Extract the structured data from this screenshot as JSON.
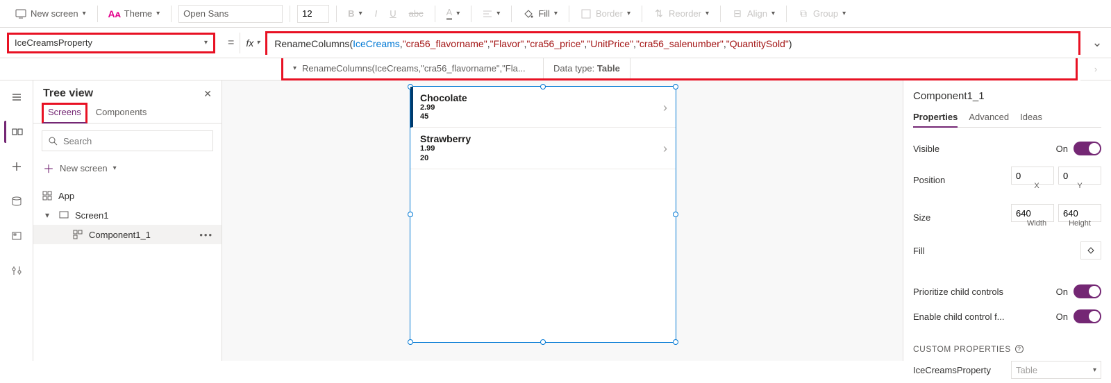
{
  "toolbar": {
    "new_screen": "New screen",
    "theme": "Theme",
    "font": "Open Sans",
    "size": "12",
    "fill": "Fill",
    "border": "Border",
    "reorder": "Reorder",
    "align": "Align",
    "group": "Group"
  },
  "formula": {
    "property": "IceCreamsProperty",
    "fx": "fx",
    "tokens": {
      "fn": "RenameColumns",
      "open": "(",
      "ident": "IceCreams",
      "c1": ",",
      "s1": "\"cra56_flavorname\"",
      "c2": ",",
      "s2": "\"Flavor\"",
      "c3": ",",
      "s3": "\"cra56_price\"",
      "c4": ",",
      "s4": "\"UnitPrice\"",
      "c5": ",",
      "s5": "\"cra56_salenumber\"",
      "c6": ",",
      "s6": "\"QuantitySold\"",
      "close": ")"
    },
    "intel_text": "RenameColumns(IceCreams,\"cra56_flavorname\",\"Fla...",
    "datatype_label": "Data type: ",
    "datatype_value": "Table"
  },
  "tree": {
    "title": "Tree view",
    "tab_screens": "Screens",
    "tab_components": "Components",
    "search_placeholder": "Search",
    "new_screen": "New screen",
    "app": "App",
    "screen1": "Screen1",
    "component": "Component1_1"
  },
  "canvas": {
    "rows": [
      {
        "title": "Chocolate",
        "price": "2.99",
        "qty": "45"
      },
      {
        "title": "Strawberry",
        "price": "1.99",
        "qty": "20"
      }
    ]
  },
  "props": {
    "title": "Component1_1",
    "tab_props": "Properties",
    "tab_adv": "Advanced",
    "tab_ideas": "Ideas",
    "visible": "Visible",
    "position": "Position",
    "pos_x": "0",
    "pos_y": "0",
    "x_lbl": "X",
    "y_lbl": "Y",
    "size": "Size",
    "w": "640",
    "h": "640",
    "w_lbl": "Width",
    "h_lbl": "Height",
    "fill": "Fill",
    "prioritize": "Prioritize child controls",
    "enable_child": "Enable child control f...",
    "on": "On",
    "custom_header": "CUSTOM PROPERTIES",
    "cp_name": "IceCreamsProperty",
    "cp_type": "Table"
  }
}
